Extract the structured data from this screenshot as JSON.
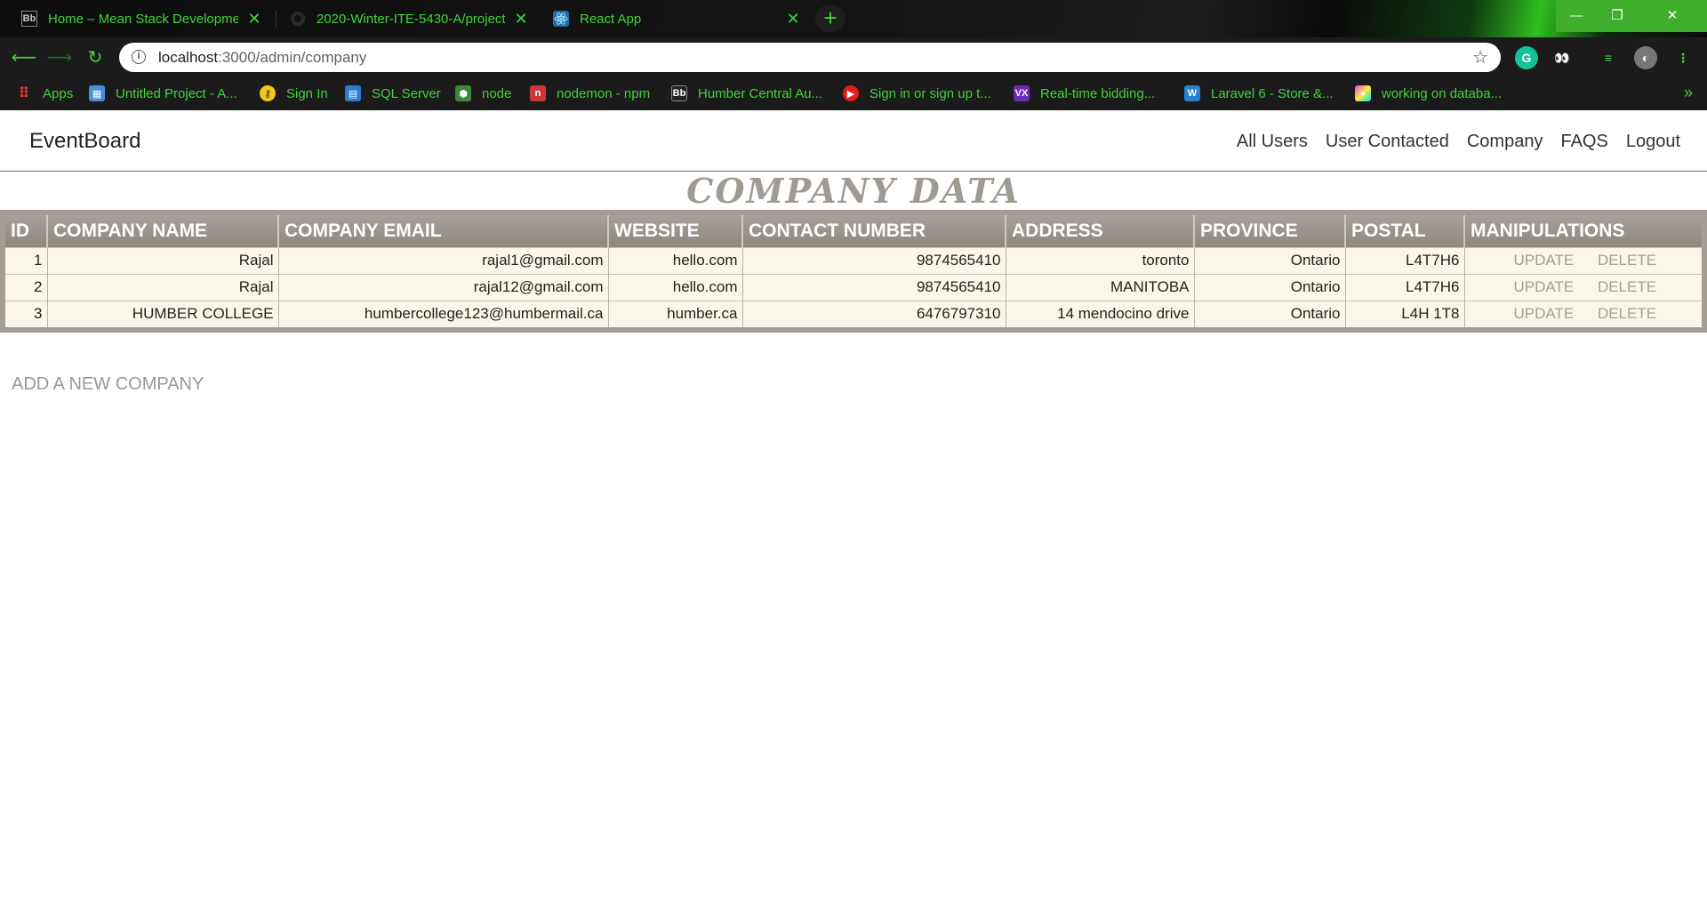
{
  "browser": {
    "tabs": [
      {
        "title": "Home – Mean Stack Developmen",
        "favicon": "Bb"
      },
      {
        "title": "2020-Winter-ITE-5430-A/project",
        "favicon": "github"
      },
      {
        "title": "React App",
        "favicon": "react"
      }
    ],
    "url_host": "localhost",
    "url_path": ":3000/admin/company",
    "bookmarks": [
      {
        "label": "Apps",
        "icon": "apps-grid",
        "color": "#e53935"
      },
      {
        "label": "Untitled Project - A...",
        "icon": "grid",
        "color": "#4a90d9"
      },
      {
        "label": "Sign In",
        "icon": "key",
        "color": "#f5c518"
      },
      {
        "label": "SQL Server",
        "icon": "sql",
        "color": "#2b7bd4"
      },
      {
        "label": "node",
        "icon": "hexagon",
        "color": "#3c873a"
      },
      {
        "label": "nodemon - npm",
        "icon": "npm",
        "color": "#cb3837"
      },
      {
        "label": "Humber Central Au...",
        "icon": "Bb",
        "color": "#333333"
      },
      {
        "label": "Sign in or sign up t...",
        "icon": "play",
        "color": "#e01e1e"
      },
      {
        "label": "Real-time bidding...",
        "icon": "vx",
        "color": "#6a2bb5"
      },
      {
        "label": "Laravel 6 - Store &...",
        "icon": "W",
        "color": "#2b80d4"
      },
      {
        "label": "working on databa...",
        "icon": "pinwheel",
        "color": "#e040fb"
      }
    ]
  },
  "app": {
    "brand": "EventBoard",
    "nav": [
      "All Users",
      "User Contacted",
      "Company",
      "FAQS",
      "Logout"
    ],
    "heading": "COMPANY DATA",
    "columns": [
      "ID",
      "COMPANY NAME",
      "COMPANY EMAIL",
      "WEBSITE",
      "CONTACT NUMBER",
      "ADDRESS",
      "PROVINCE",
      "POSTAL",
      "MANIPULATIONS"
    ],
    "rows": [
      {
        "id": "1",
        "name": "Rajal",
        "email": "rajal1@gmail.com",
        "website": "hello.com",
        "contact": "9874565410",
        "address": "toronto",
        "province": "Ontario",
        "postal": "L4T7H6"
      },
      {
        "id": "2",
        "name": "Rajal",
        "email": "rajal12@gmail.com",
        "website": "hello.com",
        "contact": "9874565410",
        "address": "MANITOBA",
        "province": "Ontario",
        "postal": "L4T7H6"
      },
      {
        "id": "3",
        "name": "HUMBER COLLEGE",
        "email": "humbercollege123@humbermail.ca",
        "website": "humber.ca",
        "contact": "6476797310",
        "address": "14 mendocino drive",
        "province": "Ontario",
        "postal": "L4H 1T8"
      }
    ],
    "update_label": "UPDATE",
    "delete_label": "DELETE",
    "add_link": "ADD A NEW COMPANY"
  }
}
